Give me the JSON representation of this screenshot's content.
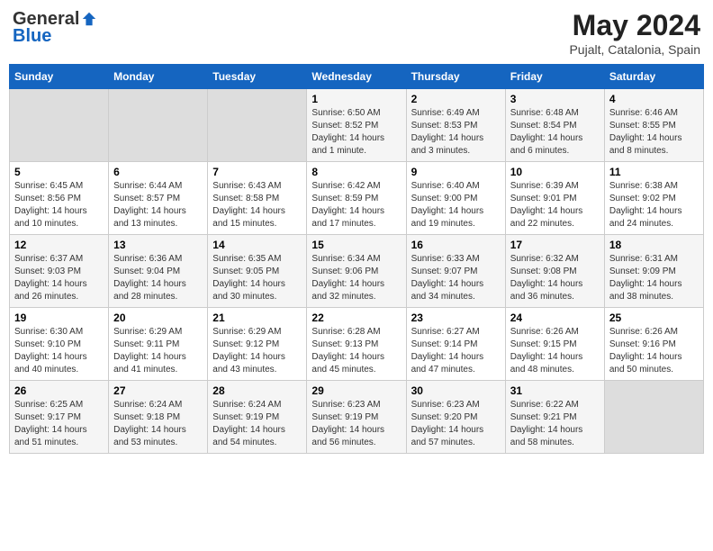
{
  "logo": {
    "general": "General",
    "blue": "Blue"
  },
  "header": {
    "title": "May 2024",
    "subtitle": "Pujalt, Catalonia, Spain"
  },
  "days_of_week": [
    "Sunday",
    "Monday",
    "Tuesday",
    "Wednesday",
    "Thursday",
    "Friday",
    "Saturday"
  ],
  "weeks": [
    [
      {
        "num": "",
        "info": ""
      },
      {
        "num": "",
        "info": ""
      },
      {
        "num": "",
        "info": ""
      },
      {
        "num": "1",
        "info": "Sunrise: 6:50 AM\nSunset: 8:52 PM\nDaylight: 14 hours\nand 1 minute."
      },
      {
        "num": "2",
        "info": "Sunrise: 6:49 AM\nSunset: 8:53 PM\nDaylight: 14 hours\nand 3 minutes."
      },
      {
        "num": "3",
        "info": "Sunrise: 6:48 AM\nSunset: 8:54 PM\nDaylight: 14 hours\nand 6 minutes."
      },
      {
        "num": "4",
        "info": "Sunrise: 6:46 AM\nSunset: 8:55 PM\nDaylight: 14 hours\nand 8 minutes."
      }
    ],
    [
      {
        "num": "5",
        "info": "Sunrise: 6:45 AM\nSunset: 8:56 PM\nDaylight: 14 hours\nand 10 minutes."
      },
      {
        "num": "6",
        "info": "Sunrise: 6:44 AM\nSunset: 8:57 PM\nDaylight: 14 hours\nand 13 minutes."
      },
      {
        "num": "7",
        "info": "Sunrise: 6:43 AM\nSunset: 8:58 PM\nDaylight: 14 hours\nand 15 minutes."
      },
      {
        "num": "8",
        "info": "Sunrise: 6:42 AM\nSunset: 8:59 PM\nDaylight: 14 hours\nand 17 minutes."
      },
      {
        "num": "9",
        "info": "Sunrise: 6:40 AM\nSunset: 9:00 PM\nDaylight: 14 hours\nand 19 minutes."
      },
      {
        "num": "10",
        "info": "Sunrise: 6:39 AM\nSunset: 9:01 PM\nDaylight: 14 hours\nand 22 minutes."
      },
      {
        "num": "11",
        "info": "Sunrise: 6:38 AM\nSunset: 9:02 PM\nDaylight: 14 hours\nand 24 minutes."
      }
    ],
    [
      {
        "num": "12",
        "info": "Sunrise: 6:37 AM\nSunset: 9:03 PM\nDaylight: 14 hours\nand 26 minutes."
      },
      {
        "num": "13",
        "info": "Sunrise: 6:36 AM\nSunset: 9:04 PM\nDaylight: 14 hours\nand 28 minutes."
      },
      {
        "num": "14",
        "info": "Sunrise: 6:35 AM\nSunset: 9:05 PM\nDaylight: 14 hours\nand 30 minutes."
      },
      {
        "num": "15",
        "info": "Sunrise: 6:34 AM\nSunset: 9:06 PM\nDaylight: 14 hours\nand 32 minutes."
      },
      {
        "num": "16",
        "info": "Sunrise: 6:33 AM\nSunset: 9:07 PM\nDaylight: 14 hours\nand 34 minutes."
      },
      {
        "num": "17",
        "info": "Sunrise: 6:32 AM\nSunset: 9:08 PM\nDaylight: 14 hours\nand 36 minutes."
      },
      {
        "num": "18",
        "info": "Sunrise: 6:31 AM\nSunset: 9:09 PM\nDaylight: 14 hours\nand 38 minutes."
      }
    ],
    [
      {
        "num": "19",
        "info": "Sunrise: 6:30 AM\nSunset: 9:10 PM\nDaylight: 14 hours\nand 40 minutes."
      },
      {
        "num": "20",
        "info": "Sunrise: 6:29 AM\nSunset: 9:11 PM\nDaylight: 14 hours\nand 41 minutes."
      },
      {
        "num": "21",
        "info": "Sunrise: 6:29 AM\nSunset: 9:12 PM\nDaylight: 14 hours\nand 43 minutes."
      },
      {
        "num": "22",
        "info": "Sunrise: 6:28 AM\nSunset: 9:13 PM\nDaylight: 14 hours\nand 45 minutes."
      },
      {
        "num": "23",
        "info": "Sunrise: 6:27 AM\nSunset: 9:14 PM\nDaylight: 14 hours\nand 47 minutes."
      },
      {
        "num": "24",
        "info": "Sunrise: 6:26 AM\nSunset: 9:15 PM\nDaylight: 14 hours\nand 48 minutes."
      },
      {
        "num": "25",
        "info": "Sunrise: 6:26 AM\nSunset: 9:16 PM\nDaylight: 14 hours\nand 50 minutes."
      }
    ],
    [
      {
        "num": "26",
        "info": "Sunrise: 6:25 AM\nSunset: 9:17 PM\nDaylight: 14 hours\nand 51 minutes."
      },
      {
        "num": "27",
        "info": "Sunrise: 6:24 AM\nSunset: 9:18 PM\nDaylight: 14 hours\nand 53 minutes."
      },
      {
        "num": "28",
        "info": "Sunrise: 6:24 AM\nSunset: 9:19 PM\nDaylight: 14 hours\nand 54 minutes."
      },
      {
        "num": "29",
        "info": "Sunrise: 6:23 AM\nSunset: 9:19 PM\nDaylight: 14 hours\nand 56 minutes."
      },
      {
        "num": "30",
        "info": "Sunrise: 6:23 AM\nSunset: 9:20 PM\nDaylight: 14 hours\nand 57 minutes."
      },
      {
        "num": "31",
        "info": "Sunrise: 6:22 AM\nSunset: 9:21 PM\nDaylight: 14 hours\nand 58 minutes."
      },
      {
        "num": "",
        "info": ""
      }
    ]
  ]
}
